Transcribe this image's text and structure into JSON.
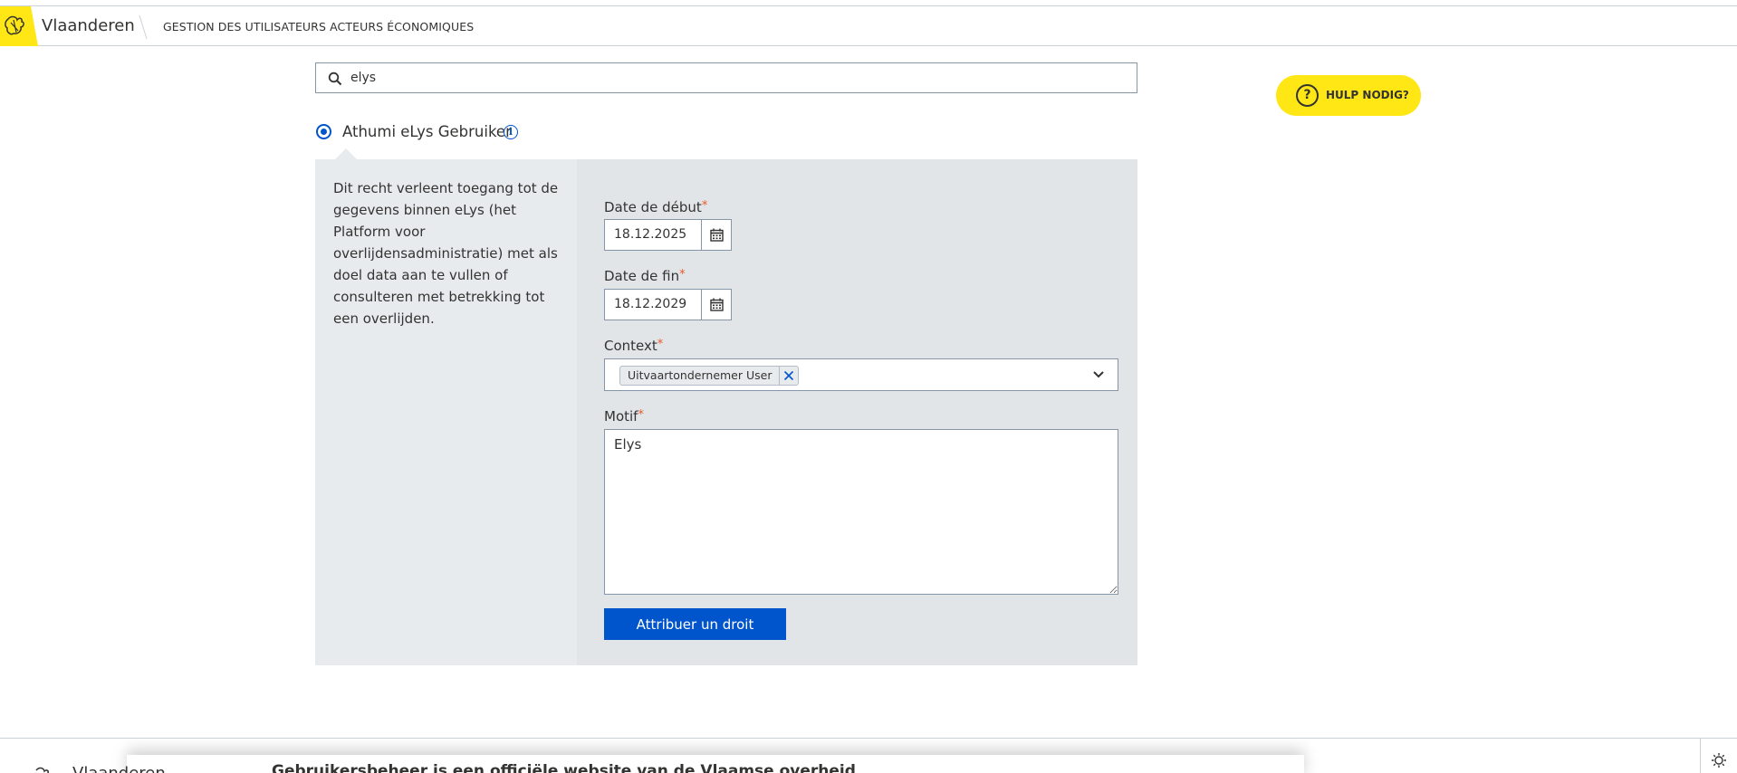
{
  "header": {
    "brand": "Vlaanderen",
    "app_title": "GESTION DES UTILISATEURS ACTEURS ÉCONOMIQUES"
  },
  "search": {
    "value": "elys",
    "icon": "search-icon"
  },
  "help": {
    "label": "HULP NODIG?",
    "icon": "question-icon"
  },
  "right": {
    "name": "Athumi eLys Gebruiker",
    "selected": true,
    "description": "Dit recht verleent toegang tot de gegevens binnen eLys (het Platform voor overlijdensadministratie) met als doel data aan te vullen of consulteren met betrekking tot een overlijden."
  },
  "form": {
    "start_date_label": "Date de début",
    "start_date_value": "18.12.2025",
    "end_date_label": "Date de fin",
    "end_date_value": "18.12.2029",
    "context_label": "Context",
    "context_selected": "Uitvaartondernemer User",
    "motif_label": "Motif",
    "motif_value": "Elys",
    "required_marker": "*",
    "submit_label": "Attribuer un droit"
  },
  "footer": {
    "brand": "Vlaanderen",
    "text": "Gebruikersbeheer is een officiële website van de Vlaamse overheid"
  },
  "colors": {
    "accent": "#0055cc",
    "brand_yellow": "#ffe615",
    "required": "#e8592a",
    "panel_bg": "#e2e5e8"
  }
}
